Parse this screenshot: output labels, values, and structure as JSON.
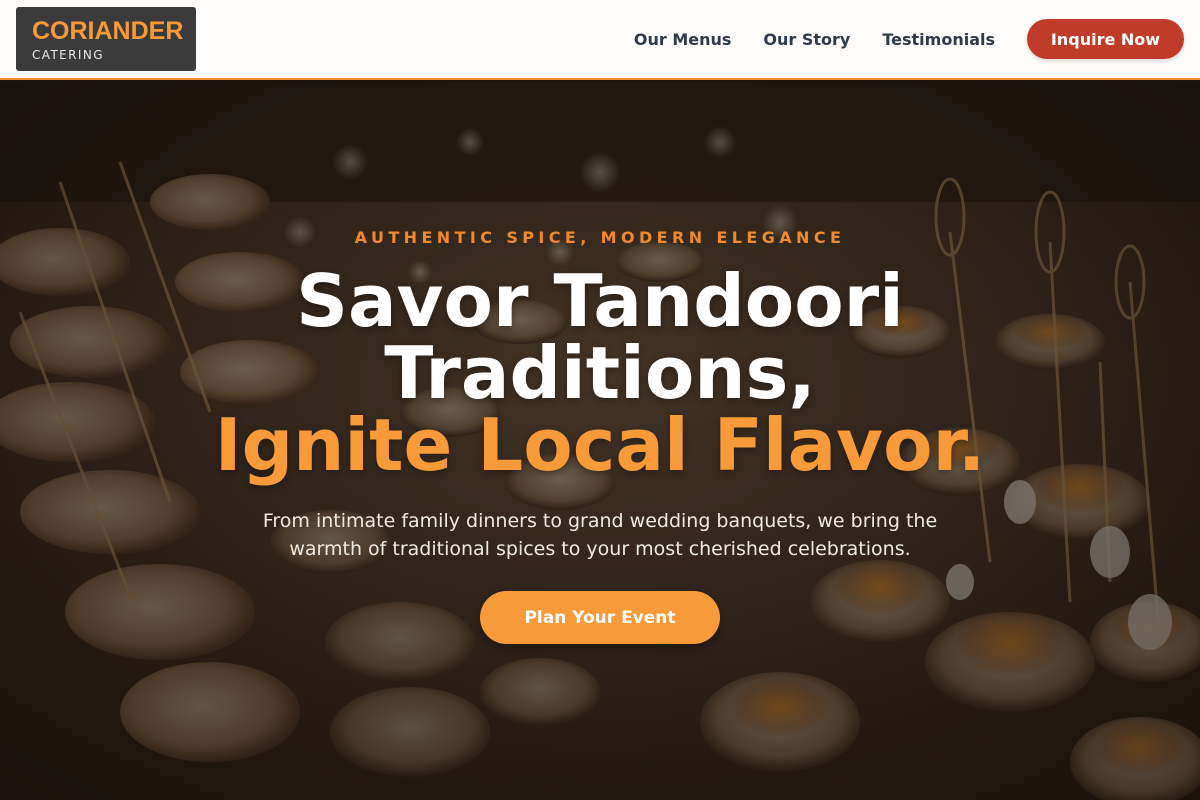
{
  "brand": {
    "name": "CORIANDER",
    "tagline": "CATERING"
  },
  "nav": {
    "links": [
      "Our Menus",
      "Our Story",
      "Testimonials"
    ],
    "cta_label": "Inquire Now"
  },
  "hero": {
    "eyebrow": "AUTHENTIC SPICE, MODERN ELEGANCE",
    "headline_line1": "Savor Tandoori",
    "headline_line2": "Traditions,",
    "headline_accent": "Ignite Local Flavor.",
    "subtext": "From intimate family dinners to grand wedding banquets, we bring the warmth of traditional spices to your most cherished celebrations.",
    "cta_label": "Plan Your Event",
    "image": "catering-appetizers-photo"
  },
  "colors": {
    "accent_orange": "#f79a3a",
    "header_cta_red": "#c13b2a",
    "nav_text": "#2f3a4a",
    "logo_bg": "#3b3b3b"
  }
}
